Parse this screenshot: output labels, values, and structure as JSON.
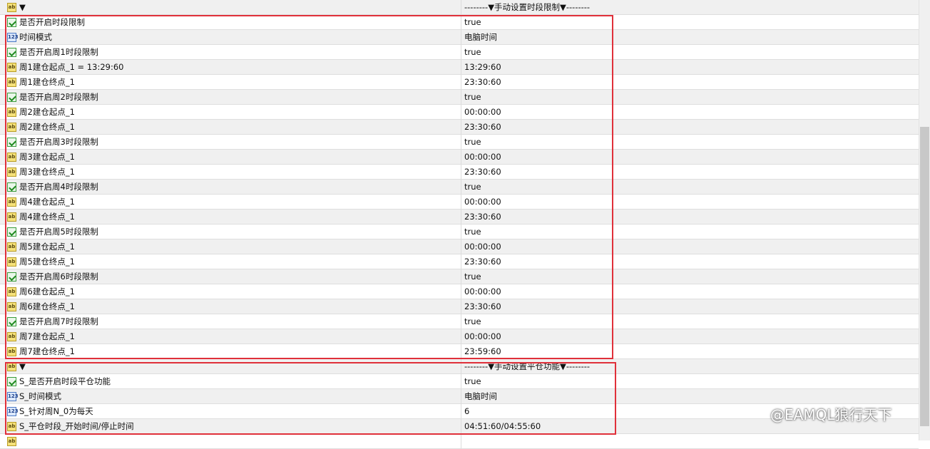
{
  "rows": [
    {
      "icon": "ab",
      "name": "▼",
      "value": "--------▼手动设置时段限制▼--------",
      "bg": "alt"
    },
    {
      "icon": "bool",
      "name": "是否开启时段限制",
      "value": "true",
      "bg": "white"
    },
    {
      "icon": "num",
      "name": "时间模式",
      "value": "电脑时间",
      "bg": "alt"
    },
    {
      "icon": "bool",
      "name": "是否开启周1时段限制",
      "value": "true",
      "bg": "white"
    },
    {
      "icon": "ab",
      "name": "周1建仓起点_1 = 13:29:60",
      "value": "13:29:60",
      "bg": "alt"
    },
    {
      "icon": "ab",
      "name": "周1建仓终点_1",
      "value": "23:30:60",
      "bg": "white"
    },
    {
      "icon": "bool",
      "name": "是否开启周2时段限制",
      "value": "true",
      "bg": "alt"
    },
    {
      "icon": "ab",
      "name": "周2建仓起点_1",
      "value": "00:00:00",
      "bg": "white"
    },
    {
      "icon": "ab",
      "name": "周2建仓终点_1",
      "value": "23:30:60",
      "bg": "alt"
    },
    {
      "icon": "bool",
      "name": "是否开启周3时段限制",
      "value": "true",
      "bg": "white"
    },
    {
      "icon": "ab",
      "name": "周3建仓起点_1",
      "value": "00:00:00",
      "bg": "alt"
    },
    {
      "icon": "ab",
      "name": "周3建仓终点_1",
      "value": "23:30:60",
      "bg": "white"
    },
    {
      "icon": "bool",
      "name": "是否开启周4时段限制",
      "value": "true",
      "bg": "alt"
    },
    {
      "icon": "ab",
      "name": "周4建仓起点_1",
      "value": "00:00:00",
      "bg": "white"
    },
    {
      "icon": "ab",
      "name": "周4建仓终点_1",
      "value": "23:30:60",
      "bg": "alt"
    },
    {
      "icon": "bool",
      "name": "是否开启周5时段限制",
      "value": "true",
      "bg": "white"
    },
    {
      "icon": "ab",
      "name": "周5建仓起点_1",
      "value": "00:00:00",
      "bg": "alt"
    },
    {
      "icon": "ab",
      "name": "周5建仓终点_1",
      "value": "23:30:60",
      "bg": "white"
    },
    {
      "icon": "bool",
      "name": "是否开启周6时段限制",
      "value": "true",
      "bg": "alt"
    },
    {
      "icon": "ab",
      "name": "周6建仓起点_1",
      "value": "00:00:00",
      "bg": "white"
    },
    {
      "icon": "ab",
      "name": "周6建仓终点_1",
      "value": "23:30:60",
      "bg": "alt"
    },
    {
      "icon": "bool",
      "name": "是否开启周7时段限制",
      "value": "true",
      "bg": "white"
    },
    {
      "icon": "ab",
      "name": "周7建仓起点_1",
      "value": "00:00:00",
      "bg": "alt"
    },
    {
      "icon": "ab",
      "name": "周7建仓终点_1",
      "value": "23:59:60",
      "bg": "white"
    },
    {
      "icon": "ab",
      "name": "▼",
      "value": "--------▼手动设置平仓功能▼--------",
      "bg": "alt"
    },
    {
      "icon": "bool",
      "name": "S_是否开启时段平仓功能",
      "value": "true",
      "bg": "white"
    },
    {
      "icon": "num",
      "name": "S_时间模式",
      "value": "电脑时间",
      "bg": "alt"
    },
    {
      "icon": "num",
      "name": "S_针对周N_0为每天",
      "value": "6",
      "bg": "white"
    },
    {
      "icon": "ab",
      "name": "S_平仓时段_开始时间/停止时间",
      "value": "04:51:60/04:55:60",
      "bg": "alt"
    },
    {
      "icon": "ab",
      "name": "",
      "value": "",
      "bg": "white"
    }
  ],
  "watermark": "@EAMQL狼行天下",
  "highlight_color": "#e0303a"
}
